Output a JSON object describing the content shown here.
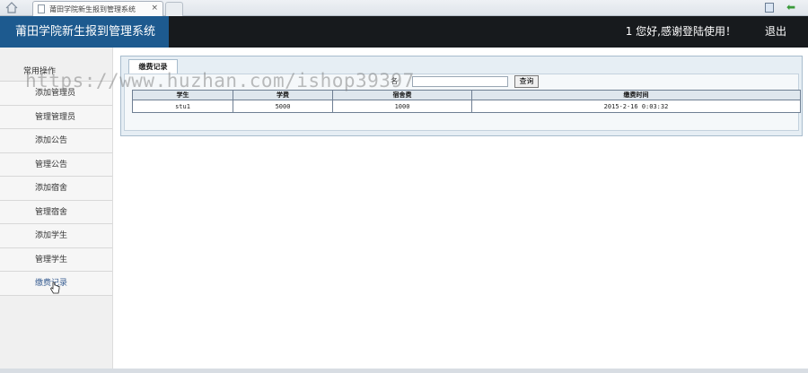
{
  "browser": {
    "tab_title": "莆田学院新生报到管理系统",
    "tab_close": "×"
  },
  "header": {
    "app_title": "莆田学院新生报到管理系统",
    "welcome": "1 您好,感谢登陆使用！",
    "logout": "退出"
  },
  "sidebar": {
    "heading": "常用操作",
    "items": [
      {
        "label": "添加管理员"
      },
      {
        "label": "管理管理员"
      },
      {
        "label": "添加公告"
      },
      {
        "label": "管理公告"
      },
      {
        "label": "添加宿舍"
      },
      {
        "label": "管理宿舍"
      },
      {
        "label": "添加学生"
      },
      {
        "label": "管理学生"
      },
      {
        "label": "缴费记录"
      }
    ],
    "active_index": 8
  },
  "main": {
    "panel_tab": "缴费记录",
    "search": {
      "label": "名",
      "value": "",
      "button": "查询"
    },
    "table": {
      "columns": [
        "学生",
        "学费",
        "宿舍费",
        "缴费时间"
      ],
      "rows": [
        [
          "stu1",
          "5000",
          "1000",
          "2015-2-16 0:03:32"
        ]
      ]
    }
  },
  "watermark": "https://www.huzhan.com/ishop39397",
  "colors": {
    "header_bg": "#171a1d",
    "title_bg": "#1d5a8f",
    "active_link": "#3a5f93"
  },
  "icons": [
    "home-icon",
    "page-icon",
    "close-icon",
    "save-icon",
    "back-arrow-icon",
    "mouse-cursor-icon"
  ]
}
